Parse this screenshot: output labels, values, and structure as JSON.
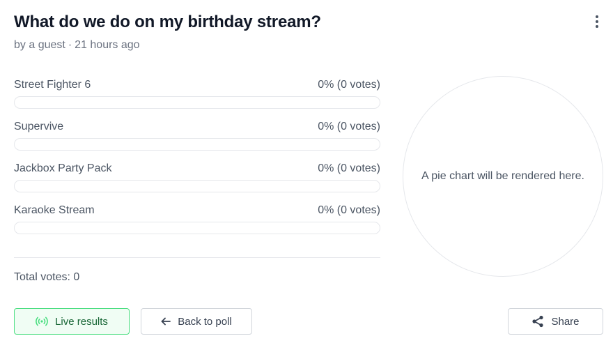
{
  "poll": {
    "title": "What do we do on my birthday stream?",
    "author": "by a guest",
    "separator": "·",
    "time_ago": "21 hours ago"
  },
  "options": [
    {
      "label": "Street Fighter 6",
      "result": "0% (0 votes)",
      "percent": 0
    },
    {
      "label": "Supervive",
      "result": "0% (0 votes)",
      "percent": 0
    },
    {
      "label": "Jackbox Party Pack",
      "result": "0% (0 votes)",
      "percent": 0
    },
    {
      "label": "Karaoke Stream",
      "result": "0% (0 votes)",
      "percent": 0
    }
  ],
  "total": {
    "text": "Total votes: 0"
  },
  "pie": {
    "placeholder": "A pie chart will be rendered here."
  },
  "buttons": {
    "live_results": "Live results",
    "back_to_poll": "Back to poll",
    "share": "Share"
  },
  "icons": {
    "more": "more-vertical-icon",
    "live": "broadcast-icon",
    "back": "arrow-left-icon",
    "share": "share-icon"
  },
  "colors": {
    "live_green_border": "#4ade80",
    "live_green_bg": "#f0fdf4",
    "live_green_text": "#166534",
    "bar_fill": "#22c55e"
  }
}
